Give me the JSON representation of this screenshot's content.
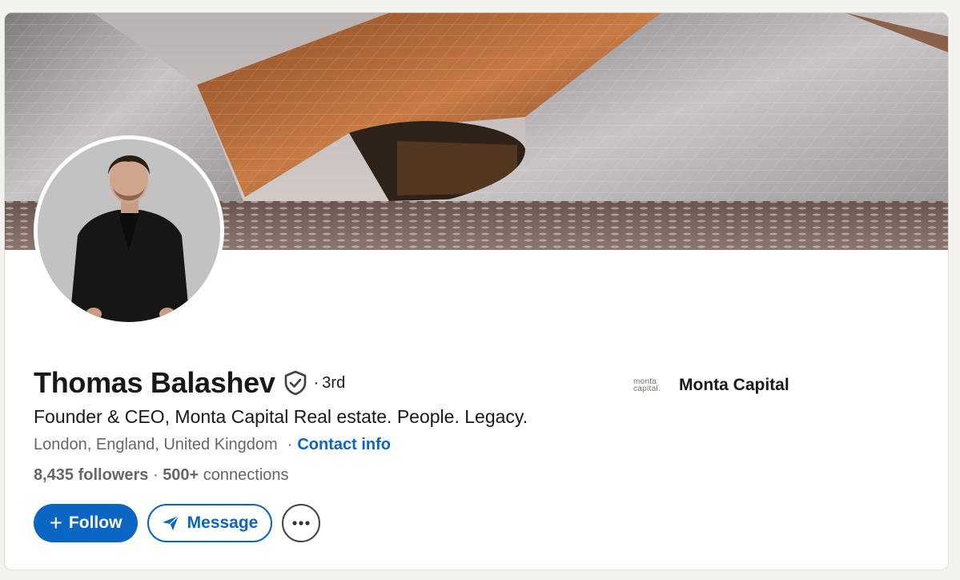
{
  "profile": {
    "name": "Thomas Balashev",
    "degree": "3rd",
    "degree_separator": "·",
    "headline": "Founder & CEO, Monta Capital Real estate. People. Legacy.",
    "location": "London, England, United Kingdom",
    "location_separator": "·",
    "contact_label": "Contact info",
    "followers_count": "8,435 followers",
    "stats_separator": " · ",
    "connections_count": "500+",
    "connections_label": " connections"
  },
  "company": {
    "logo_line1": "monta",
    "logo_line2": "capital.",
    "name": "Monta Capital"
  },
  "actions": {
    "follow_label": "Follow",
    "follow_icon": "plus-icon",
    "message_label": "Message",
    "message_icon": "paper-plane-icon",
    "more_icon": "ellipsis-icon"
  },
  "colors": {
    "accent": "#0a66c2",
    "text_primary": "#191919",
    "text_secondary": "#666666",
    "background": "#f4f2ee"
  }
}
